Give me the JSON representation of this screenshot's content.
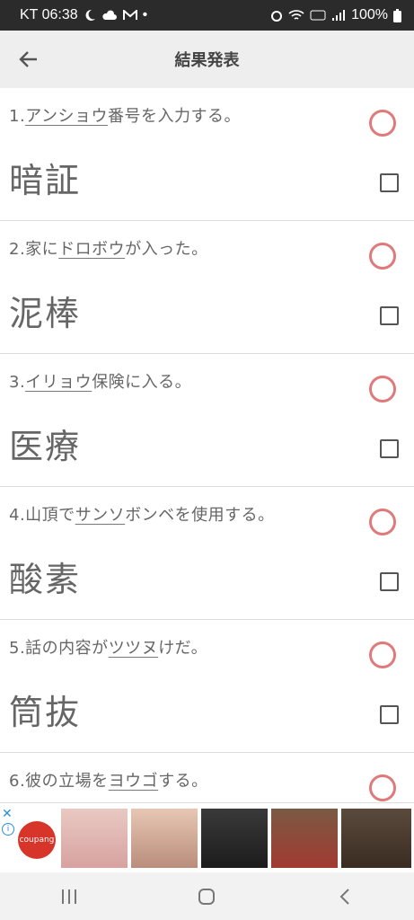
{
  "status": {
    "carrier_time": "KT 06:38",
    "battery": "100%"
  },
  "appbar": {
    "title": "結果発表"
  },
  "questions": [
    {
      "num": "1.",
      "kana": "アンショウ",
      "rest": "番号を入力する。",
      "answer": "暗証"
    },
    {
      "num": "2.家に",
      "kana": "ドロボウ",
      "rest": "が入った。",
      "answer": "泥棒"
    },
    {
      "num": "3.",
      "kana": "イリョウ",
      "rest": "保険に入る。",
      "answer": "医療"
    },
    {
      "num": "4.山頂で",
      "kana": "サンソ",
      "rest": "ボンベを使用する。",
      "answer": "酸素"
    },
    {
      "num": "5.話の内容が",
      "kana": "ツツヌ",
      "rest": "けだ。",
      "answer": "筒抜"
    },
    {
      "num": "6.彼の立場を",
      "kana": "ヨウゴ",
      "rest": "する。",
      "answer": ""
    }
  ],
  "ad": {
    "brand": "coupang"
  }
}
